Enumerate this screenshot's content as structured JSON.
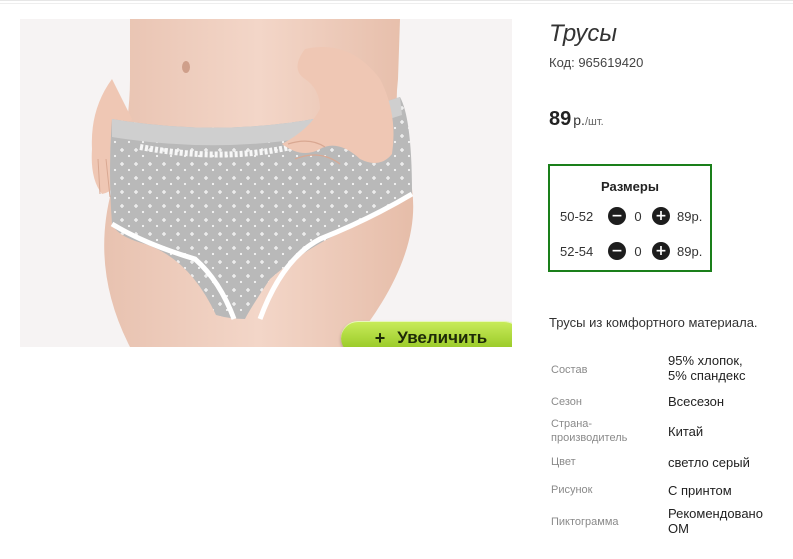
{
  "product": {
    "title": "Трусы",
    "code": "Код: 965619420",
    "price_value": "89",
    "price_currency": "р.",
    "price_unit": "/шт.",
    "zoom_label": "Увеличить",
    "zoom_icon": "+",
    "description": "Трусы из комфортного материала."
  },
  "sizes": {
    "header": "Размеры",
    "rows": [
      {
        "size": "50-52",
        "qty": "0",
        "price": "89р."
      },
      {
        "size": "52-54",
        "qty": "0",
        "price": "89р."
      }
    ]
  },
  "properties": [
    {
      "key": "Состав",
      "value": "95% хлопок,\n5% спандекс"
    },
    {
      "key": "Сезон",
      "value": "Всесезон"
    },
    {
      "key": "Страна-\nпроизводитель",
      "value": "Китай"
    },
    {
      "key": "Цвет",
      "value": "светло серый"
    },
    {
      "key": "Рисунок",
      "value": "С принтом"
    },
    {
      "key": "Пиктограмма",
      "value": "Рекомендовано\nОМ"
    }
  ],
  "colors": {
    "accent_border": "#1a7f1a",
    "button_green": "#a6d32f"
  }
}
